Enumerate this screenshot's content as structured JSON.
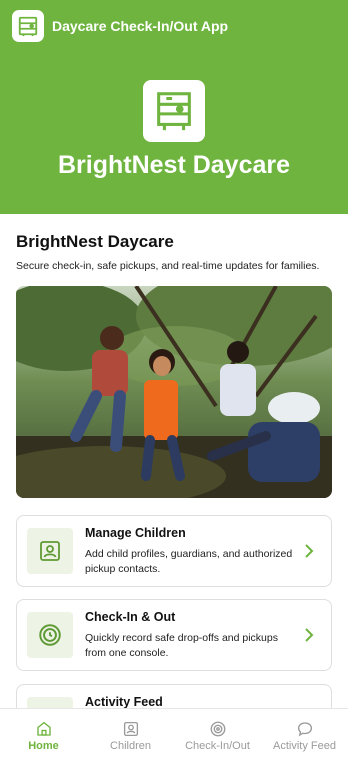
{
  "app": {
    "title": "Daycare Check-In/Out App",
    "icon": "shelf-icon"
  },
  "hero": {
    "logo_icon": "shelf-icon",
    "title": "BrightNest Daycare"
  },
  "main": {
    "title": "BrightNest Daycare",
    "subtitle": "Secure check-in, safe pickups, and real-time updates for families.",
    "photo_icon": "children-playing-photo"
  },
  "cards": [
    {
      "icon": "profile-card-icon",
      "title": "Manage Children",
      "description": "Add child profiles, guardians, and authorized pickup contacts."
    },
    {
      "icon": "clock-icon",
      "title": "Check-In & Out",
      "description": "Quickly record safe drop-offs and pickups from one console."
    },
    {
      "icon": "feed-icon",
      "title": "Activity Feed",
      "description": ""
    }
  ],
  "tabs": [
    {
      "label": "Home",
      "icon": "home-icon",
      "active": true
    },
    {
      "label": "Children",
      "icon": "profile-icon",
      "active": false
    },
    {
      "label": "Check-In/Out",
      "icon": "target-icon",
      "active": false
    },
    {
      "label": "Activity Feed",
      "icon": "chat-icon",
      "active": false
    }
  ],
  "colors": {
    "brand": "#6fb43f",
    "card_icon_bg": "#edf3e5",
    "inactive_tab": "#9a9a9a"
  }
}
